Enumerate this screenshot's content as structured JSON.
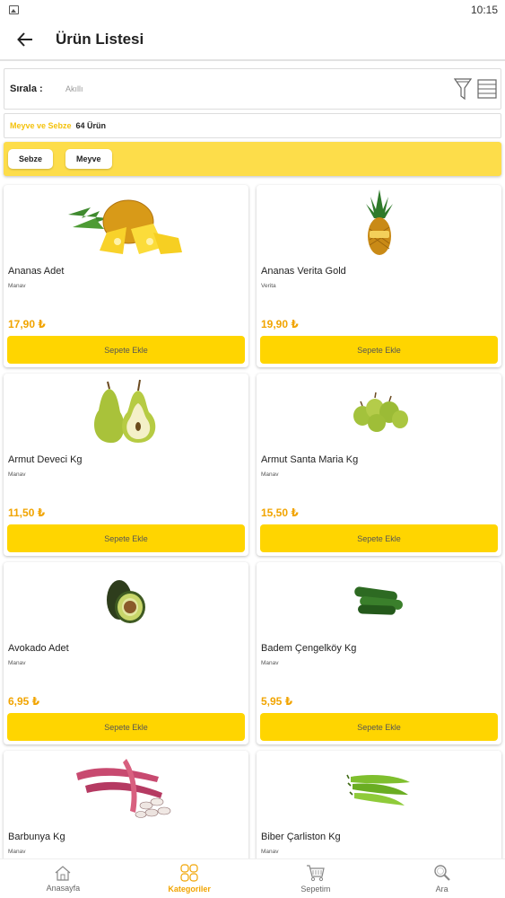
{
  "status_bar": {
    "time": "10:15"
  },
  "header": {
    "title": "Ürün Listesi"
  },
  "sort": {
    "label": "Sırala :",
    "value": "Akıllı"
  },
  "category": {
    "name": "Meyve ve Sebze",
    "count": "64 Ürün"
  },
  "chips": [
    {
      "label": "Sebze"
    },
    {
      "label": "Meyve"
    }
  ],
  "products": [
    {
      "name": "Ananas Adet",
      "brand": "Manav",
      "price": "17,90 ₺",
      "button": "Sepete Ekle",
      "image": "pineapple-sliced-image"
    },
    {
      "name": "Ananas Verita Gold",
      "brand": "Verita",
      "price": "19,90 ₺",
      "button": "Sepete Ekle",
      "image": "pineapple-whole-image"
    },
    {
      "name": "Armut Deveci Kg",
      "brand": "Manav",
      "price": "11,50 ₺",
      "button": "Sepete Ekle",
      "image": "pear-image"
    },
    {
      "name": "Armut Santa Maria Kg",
      "brand": "Manav",
      "price": "15,50 ₺",
      "button": "Sepete Ekle",
      "image": "small-pears-image"
    },
    {
      "name": "Avokado Adet",
      "brand": "Manav",
      "price": "6,95 ₺",
      "button": "Sepete Ekle",
      "image": "avocado-image"
    },
    {
      "name": "Badem Çengelköy Kg",
      "brand": "Manav",
      "price": "5,95 ₺",
      "button": "Sepete Ekle",
      "image": "cucumber-image"
    },
    {
      "name": "Barbunya Kg",
      "brand": "Manav",
      "price": "",
      "button": "",
      "image": "beans-image"
    },
    {
      "name": "Biber Çarliston Kg",
      "brand": "Manav",
      "price": "",
      "button": "",
      "image": "green-pepper-image"
    }
  ],
  "bottom_nav": [
    {
      "label": "Anasayfa",
      "icon": "home-icon"
    },
    {
      "label": "Kategoriler",
      "icon": "grid-icon"
    },
    {
      "label": "Sepetim",
      "icon": "cart-icon"
    },
    {
      "label": "Ara",
      "icon": "search-icon"
    }
  ],
  "colors": {
    "accent": "#FFD500",
    "price": "#F1A400",
    "category": "#F4C20D",
    "chip_bar": "#FDDD4A"
  }
}
